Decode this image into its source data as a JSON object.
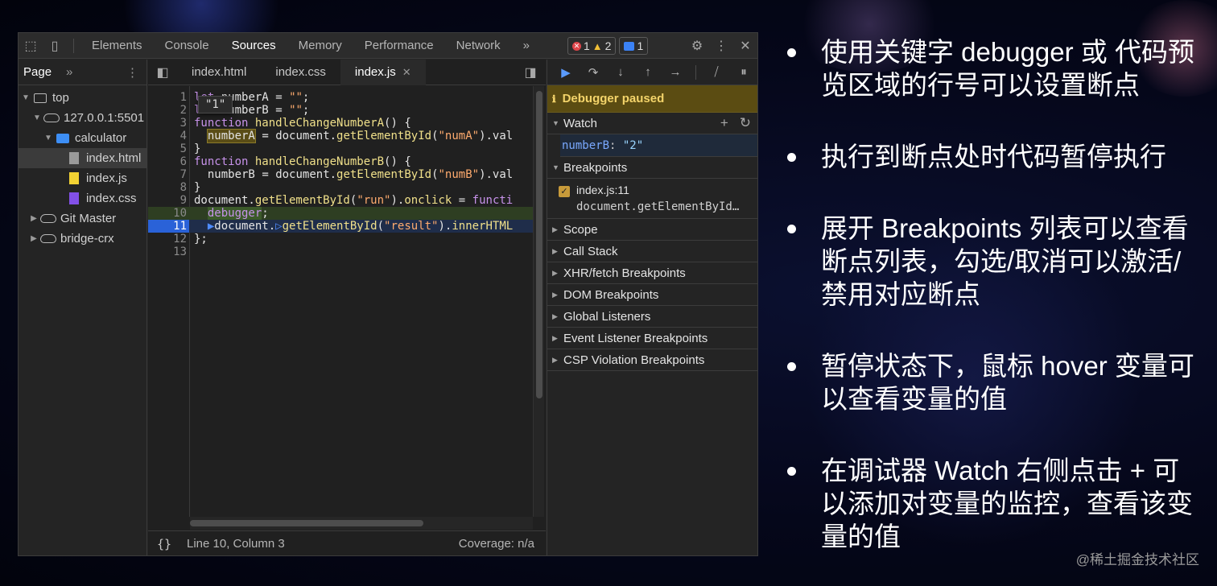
{
  "devtools": {
    "tabs": [
      "Elements",
      "Console",
      "Sources",
      "Memory",
      "Performance",
      "Network"
    ],
    "active_tab": "Sources",
    "more_tabs": "»",
    "badges": {
      "errors": "1",
      "warnings": "2",
      "messages": "1"
    },
    "navigator": {
      "tab_label": "Page",
      "more": "»",
      "tree": [
        {
          "label": "top",
          "icon": "frame-icon",
          "arrow": "▼"
        },
        {
          "label": "127.0.0.1:5501",
          "icon": "cloud-icon",
          "arrow": "▼"
        },
        {
          "label": "calculator",
          "icon": "folder-icon",
          "arrow": "▼"
        },
        {
          "label": "index.html",
          "icon": "html-file-icon",
          "arrow": ""
        },
        {
          "label": "index.js",
          "icon": "js-file-icon",
          "arrow": ""
        },
        {
          "label": "index.css",
          "icon": "css-file-icon",
          "arrow": ""
        },
        {
          "label": "Git Master",
          "icon": "cloud-icon",
          "arrow": "▶"
        },
        {
          "label": "bridge-crx",
          "icon": "cloud-icon",
          "arrow": "▶"
        }
      ]
    },
    "editor": {
      "file_tabs": [
        "index.html",
        "index.css",
        "index.js"
      ],
      "active_file": "index.js",
      "hover_tooltip": "\"1\"",
      "line_numbers": [
        "1",
        "2",
        "3",
        "4",
        "5",
        "6",
        "7",
        "8",
        "9",
        "10",
        "11",
        "12",
        "13"
      ],
      "status": {
        "braces": "{}",
        "position": "Line 10, Column 3",
        "coverage": "Coverage: n/a"
      }
    },
    "debugger": {
      "paused_label": "Debugger paused",
      "watch_label": "Watch",
      "watch_expr_key": "numberB",
      "watch_expr_sep": ": ",
      "watch_expr_value": "\"2\"",
      "breakpoints_label": "Breakpoints",
      "breakpoint_location": "index.js:11",
      "breakpoint_code": "document.getElementById…",
      "sections": [
        "Scope",
        "Call Stack",
        "XHR/fetch Breakpoints",
        "DOM Breakpoints",
        "Global Listeners",
        "Event Listener Breakpoints",
        "CSP Violation Breakpoints"
      ]
    }
  },
  "slide": {
    "bullets": [
      "使用关键字 debugger 或 代码预览区域的行号可以设置断点",
      "执行到断点处时代码暂停执行",
      "展开 Breakpoints 列表可以查看断点列表，勾选/取消可以激活/禁用对应断点",
      "暂停状态下，鼠标 hover 变量可以查看变量的值",
      "在调试器 Watch 右侧点击 + 可以添加对变量的监控，查看该变量的值"
    ],
    "credit": "@稀土掘金技术社区"
  }
}
